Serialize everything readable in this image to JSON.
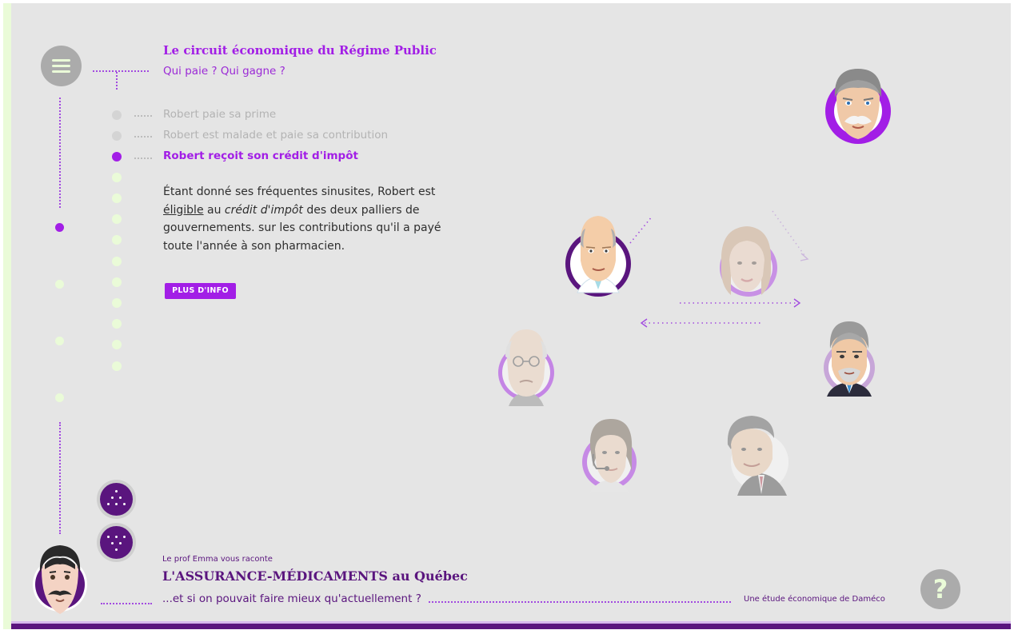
{
  "colors": {
    "accent": "#a21ee6",
    "deep_purple": "#5a157e",
    "mint": "#eafbd8",
    "background": "#e5e5e5"
  },
  "header": {
    "title": "Le circuit économique du Régime Public",
    "subtitle": "Qui paie ? Qui gagne ?"
  },
  "steps": [
    {
      "label": "Robert paie sa prime",
      "state": "done"
    },
    {
      "label": "Robert est malade et paie sa contribution",
      "state": "done"
    },
    {
      "label": "Robert reçoit son crédit d'impôt",
      "state": "active"
    }
  ],
  "description": {
    "p1": "Étant donné ses fréquentes sinusites, Robert est ",
    "eligible": "éligible",
    "p2": " au ",
    "credit": "crédit d'impôt",
    "p3": " des deux palliers de gouvernements. sur les contributions qu'il a payé toute l'année à son pharmacien."
  },
  "more_info_label": "PLUS D'INFO",
  "footer": {
    "intro": "Le prof Emma vous raconte",
    "title_main": "L'ASSURANCE-MÉDICAMENTS",
    "title_rest": " au Québec",
    "tagline": "...et si on pouvait faire mieux qu'actuellement ?",
    "credit": "Une étude économique de Daméco"
  },
  "help_label": "?",
  "icons": {
    "menu": "hamburger-icon",
    "nav_up": "dots-triangle-up-icon",
    "nav_down": "dots-triangle-down-icon",
    "help": "question-mark-icon"
  }
}
